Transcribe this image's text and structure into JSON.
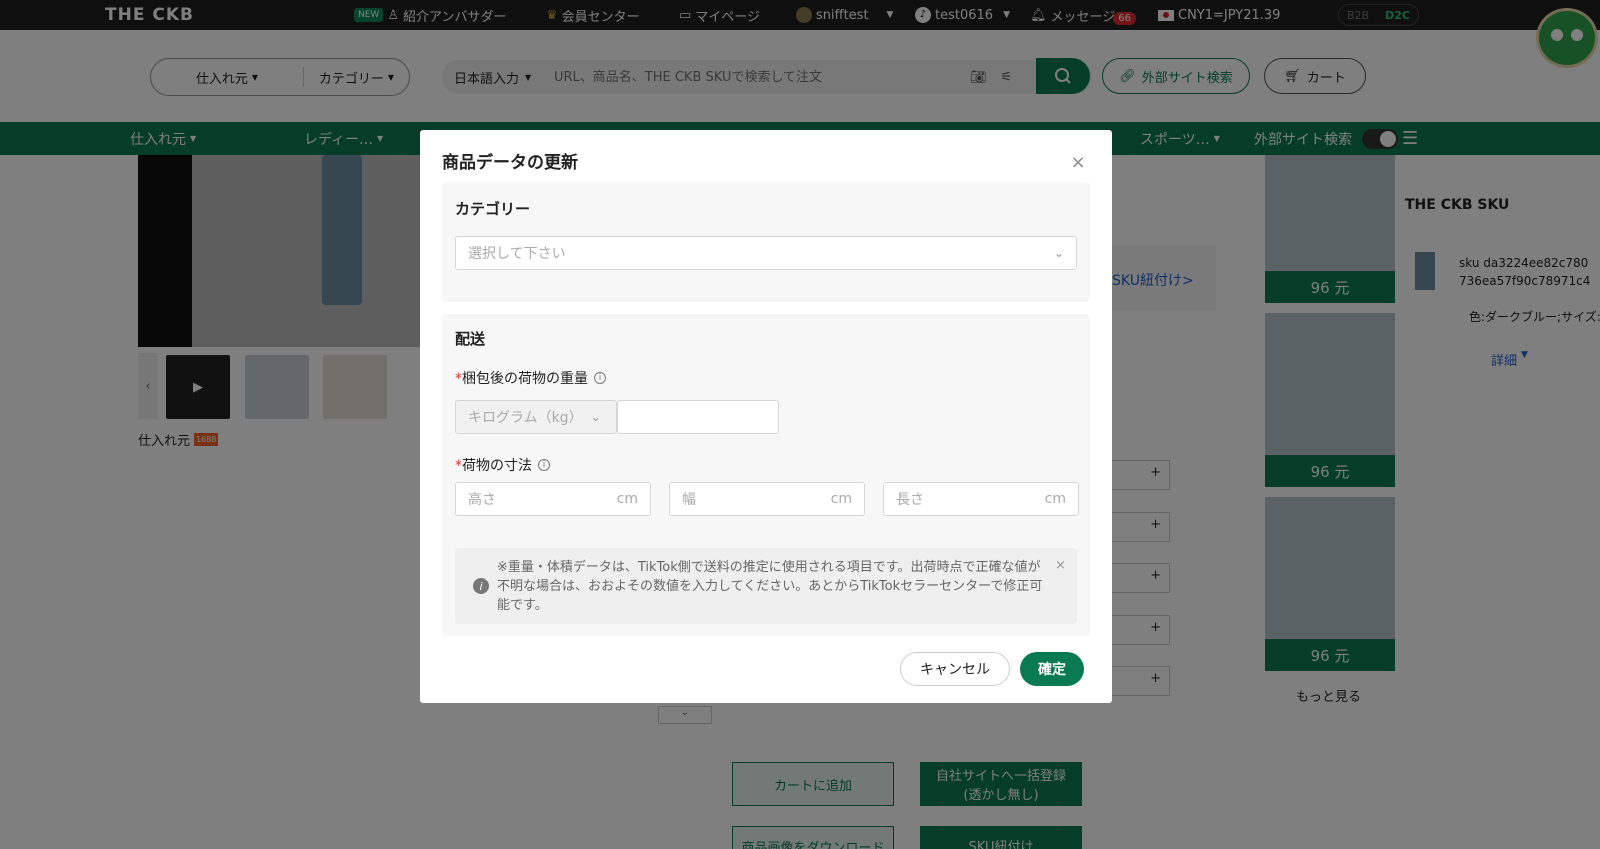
{
  "topbar": {
    "logo": "THE CKB",
    "new_tag": "NEW",
    "ambassador": "紹介アンバサダー",
    "member_center": "会員センター",
    "mypage": "マイページ",
    "user": "snifftest",
    "tiktok_account": "test0616",
    "messages": "メッセージ",
    "message_count": "66",
    "currency": "CNY1=JPY21.39",
    "b2b": "B2B",
    "d2c": "D2C"
  },
  "header": {
    "source_filter": "仕入れ元",
    "category_filter": "カテゴリー",
    "lang_select": "日本語入力",
    "search_placeholder": "URL、商品名、THE CKB SKUで検索して注文",
    "external_search": "外部サイト検索",
    "cart": "カート"
  },
  "navbar": {
    "source": "仕入れ元",
    "ladies": "レディー…",
    "sports": "スポーツ…",
    "external_search": "外部サイト検索"
  },
  "background": {
    "source_label": "仕入れ元",
    "source_badge": "1688",
    "sku_link": "SKU紐付け>",
    "panel_title": "THE CKB SKU",
    "sku_line1": "sku da3224ee82c780",
    "sku_line2": "736ea57f90c78971c4",
    "variant": "色:ダークブルー;サイズ:",
    "detail": "詳細",
    "prices": [
      "96 元",
      "96 元",
      "96 元"
    ],
    "more": "もっと見る",
    "add_to_cart": "カートに追加",
    "bulk_register": "自社サイトへ一括登録",
    "bulk_register_sub": "(透かし無し)",
    "download_images": "商品画像をダウンロード",
    "sku_bind": "SKU紐付け"
  },
  "modal": {
    "title": "商品データの更新",
    "category_section": "カテゴリー",
    "category_placeholder": "選択して下さい",
    "shipping_section": "配送",
    "weight_label": "梱包後の荷物の重量",
    "weight_unit": "キログラム（kg）",
    "size_label": "荷物の寸法",
    "height_placeholder": "高さ",
    "width_placeholder": "幅",
    "length_placeholder": "長さ",
    "unit_cm": "cm",
    "required_mark": "*",
    "note": "※重量・体積データは、TikTok側で送料の推定に使用される項目です。出荷時点で正確な値が不明な場合は、おおよその数値を入力してください。あとからTikTokセラーセンターで修正可能です。",
    "cancel": "キャンセル",
    "confirm": "確定"
  },
  "colors": {
    "brand_green": "#0a7a52",
    "alert_red": "#e02d2d"
  }
}
